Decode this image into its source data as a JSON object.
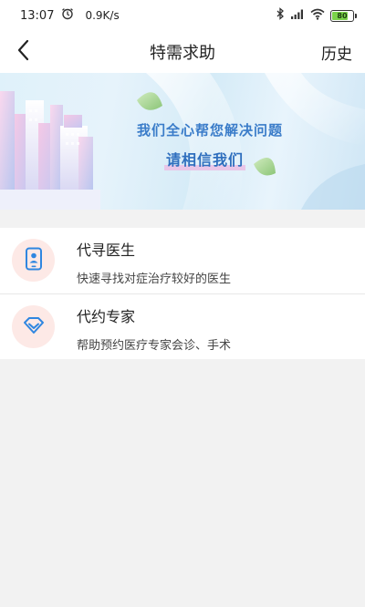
{
  "status_bar": {
    "time": "13:07",
    "network_speed": "0.9K/s",
    "battery_level": "80",
    "icons": [
      "alarm-icon",
      "bluetooth-icon",
      "signal-icon",
      "wifi-icon",
      "battery-icon"
    ]
  },
  "nav": {
    "title": "特需求助",
    "back_icon": "chevron-left-icon",
    "history_label": "历史"
  },
  "banner": {
    "line1": "我们全心帮您解决问题",
    "line2": "请相信我们"
  },
  "services": [
    {
      "title": "代寻医生",
      "description": "快速寻找对症治疗较好的医生",
      "icon": "doctor-phone-icon"
    },
    {
      "title": "代约专家",
      "description": "帮助预约医疗专家会诊、手术",
      "icon": "diamond-icon"
    }
  ],
  "colors": {
    "accent_blue": "#2f6fbe",
    "icon_blue": "#2f86e0",
    "icon_bg": "#fde9e6",
    "page_bg": "#f2f2f2",
    "battery_green": "#7bd44a"
  }
}
